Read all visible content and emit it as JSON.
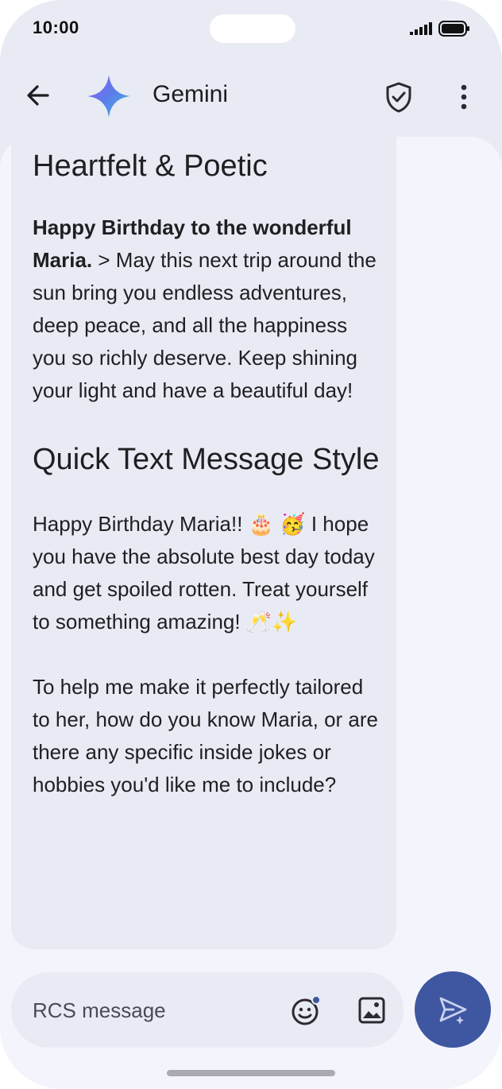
{
  "status_bar": {
    "time": "10:00"
  },
  "header": {
    "title": "Gemini",
    "back_icon": "arrow-left-icon",
    "logo_icon": "gemini-sparkle-icon",
    "shield_icon": "shield-check-icon",
    "more_icon": "more-vert-icon"
  },
  "message": {
    "heading1": "Heartfelt & Poetic",
    "para1_bold": "Happy Birthday to the wonderful Maria.",
    "para1_rest": " > May this next trip around the sun bring you endless adventures, deep peace, and all the happiness you so richly deserve. Keep shining your light and have a beautiful day!",
    "heading2": "Quick Text Message Style",
    "para2": "Happy Birthday Maria!! 🎂 🥳 I hope you have the absolute best day today and get spoiled rotten. Treat yourself to something amazing! 🥂✨",
    "para3": "To help me make it perfectly tailored to her, how do you know Maria, or are there any specific inside jokes or hobbies you'd like me to include?"
  },
  "composer": {
    "placeholder": "RCS message",
    "emoji_icon": "emoji-icon",
    "image_icon": "image-icon",
    "send_icon": "send-icon"
  },
  "colors": {
    "background": "#e9ebf4",
    "chat_background": "#f4f5fc",
    "send_button": "#3f57a0",
    "text": "#1f1f22"
  }
}
